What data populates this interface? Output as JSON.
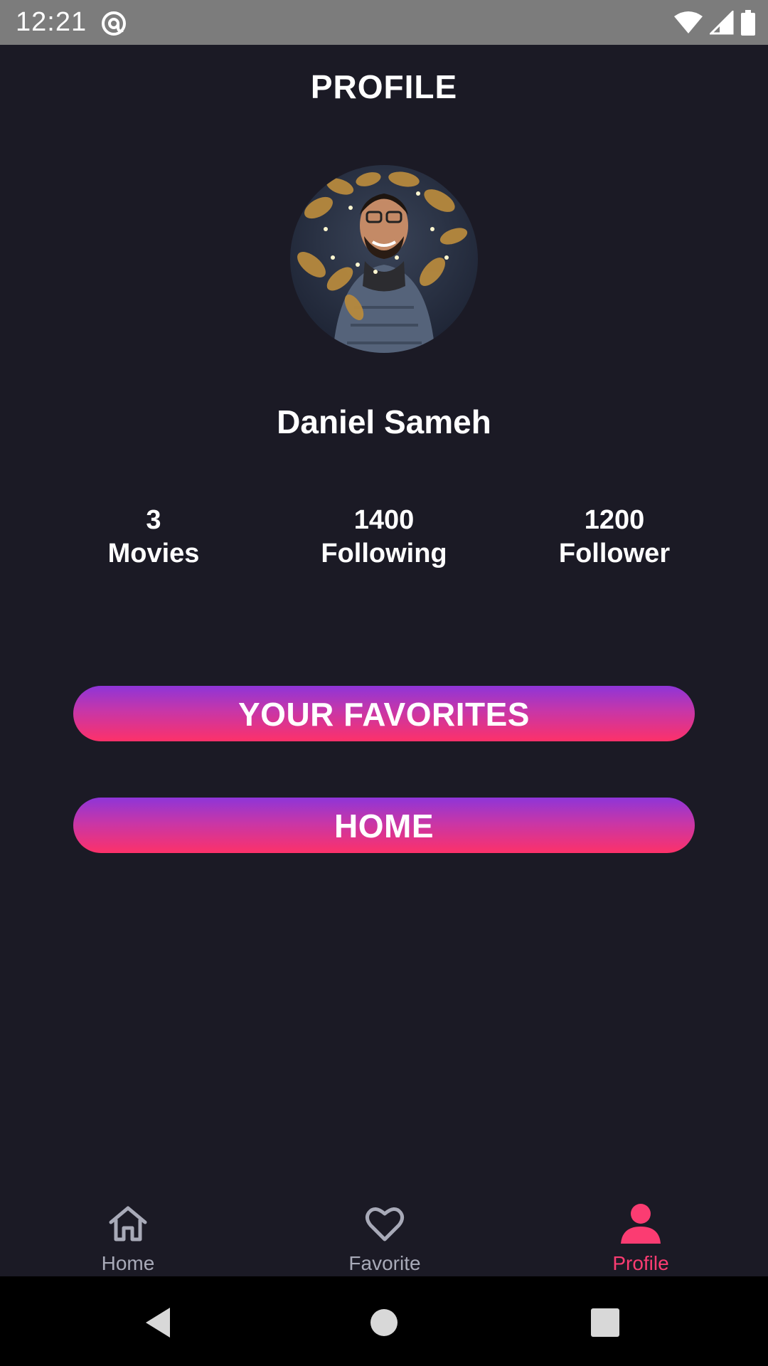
{
  "status_bar": {
    "time": "12:21",
    "icons": [
      "at-sign-icon",
      "wifi-icon",
      "signal-icon",
      "battery-icon"
    ]
  },
  "header": {
    "title": "PROFILE"
  },
  "profile": {
    "avatar": "avatar-photo",
    "name": "Daniel Sameh",
    "stats": [
      {
        "value": "3",
        "label": "Movies"
      },
      {
        "value": "1400",
        "label": "Following"
      },
      {
        "value": "1200",
        "label": "Follower"
      }
    ]
  },
  "buttons": {
    "favorites_label": "YOUR FAVORITES",
    "home_label": "HOME"
  },
  "bottom_nav": {
    "items": [
      {
        "label": "Home",
        "icon": "home-icon",
        "active": false
      },
      {
        "label": "Favorite",
        "icon": "heart-icon",
        "active": false
      },
      {
        "label": "Profile",
        "icon": "person-icon",
        "active": true
      }
    ]
  },
  "colors": {
    "background": "#1b1a25",
    "accent": "#fb3c72",
    "gradient_top": "#8e35d8",
    "gradient_bottom": "#fd3169",
    "inactive_nav": "#a8aab8"
  }
}
